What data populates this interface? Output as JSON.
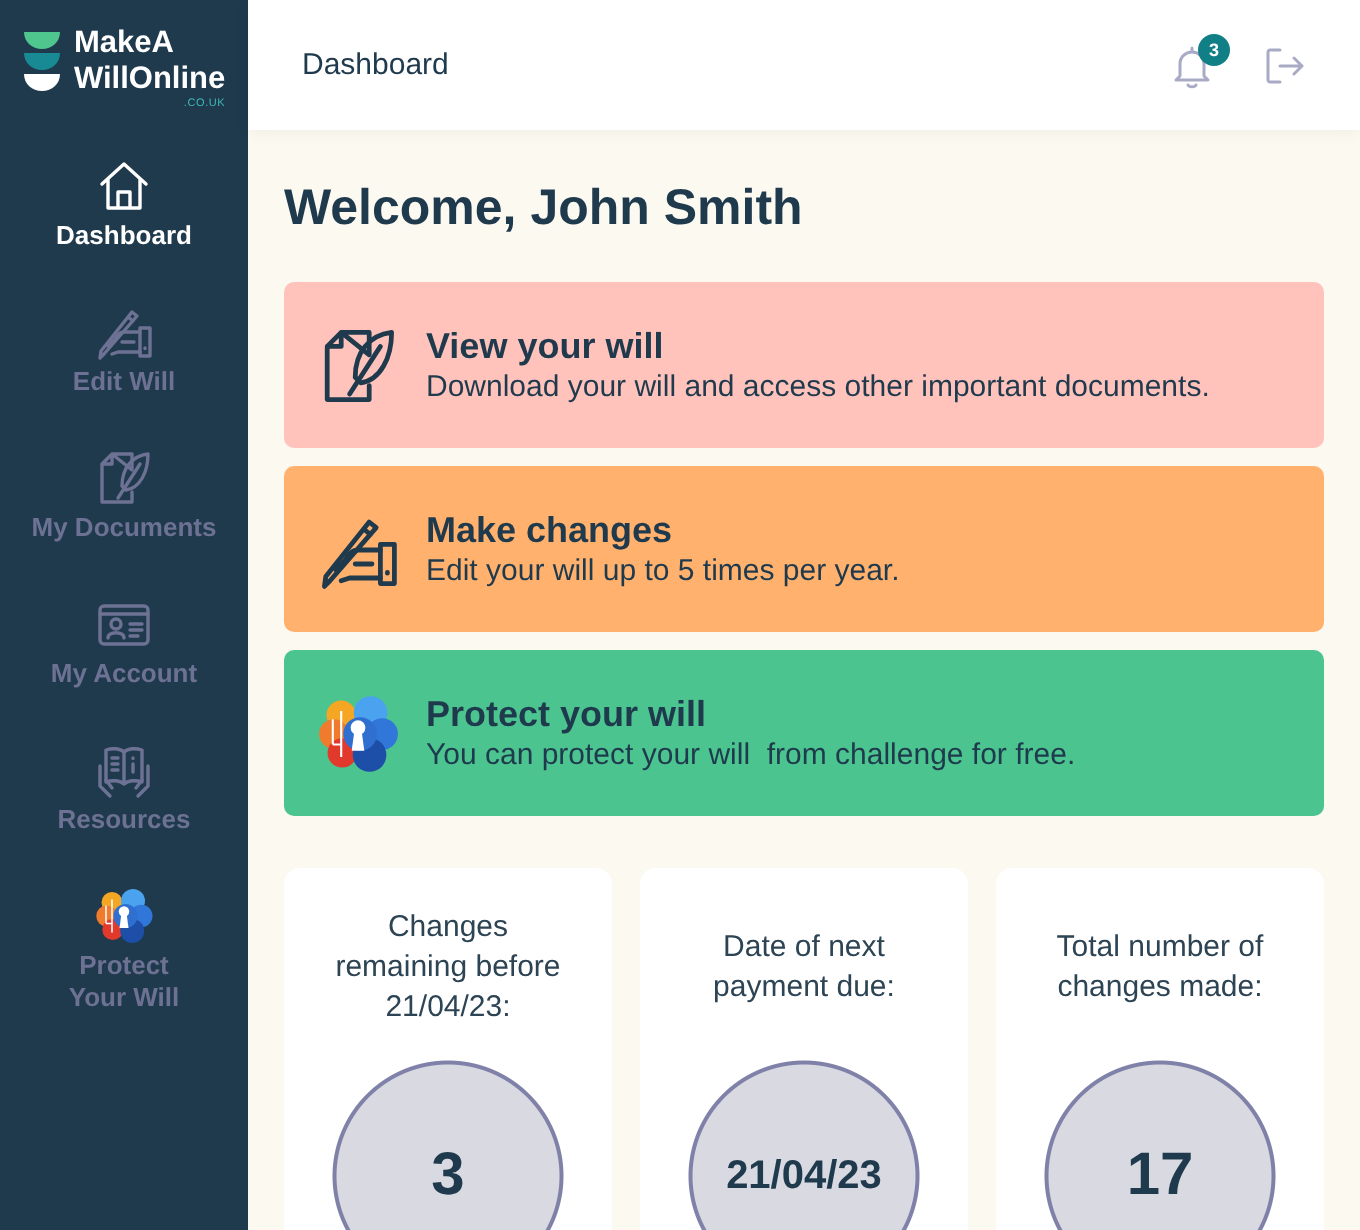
{
  "logo": {
    "lines": [
      "MakeA",
      "WillOnline"
    ],
    "domain": ".CO.UK"
  },
  "sidebar": {
    "items": [
      {
        "label": "Dashboard",
        "selected": true
      },
      {
        "label": "Edit Will",
        "selected": false
      },
      {
        "label": "My Documents",
        "selected": false
      },
      {
        "label": "My Account",
        "selected": false
      },
      {
        "label": "Resources",
        "selected": false
      },
      {
        "label": "Protect Your Will",
        "selected": false
      }
    ]
  },
  "header": {
    "title": "Dashboard",
    "notification_count": "3"
  },
  "welcome": "Welcome, John Smith",
  "actions": [
    {
      "title": "View your will",
      "description": "Download your will and access other important documents.",
      "color": "#ffc3bc"
    },
    {
      "title": "Make changes",
      "description": "Edit your will up to 5 times per year.",
      "color": "#ffb16d"
    },
    {
      "title": "Protect your will",
      "description": "You can protect your will  from challenge for free.",
      "color": "#4cc490"
    }
  ],
  "stats": [
    {
      "kind": "count",
      "label": "Changes remaining before 21/04/23:",
      "value": "3"
    },
    {
      "kind": "date",
      "label": "Date of next payment due:",
      "value": "21/04/23"
    },
    {
      "kind": "count",
      "label": "Total number of changes made:",
      "value": "17"
    }
  ]
}
